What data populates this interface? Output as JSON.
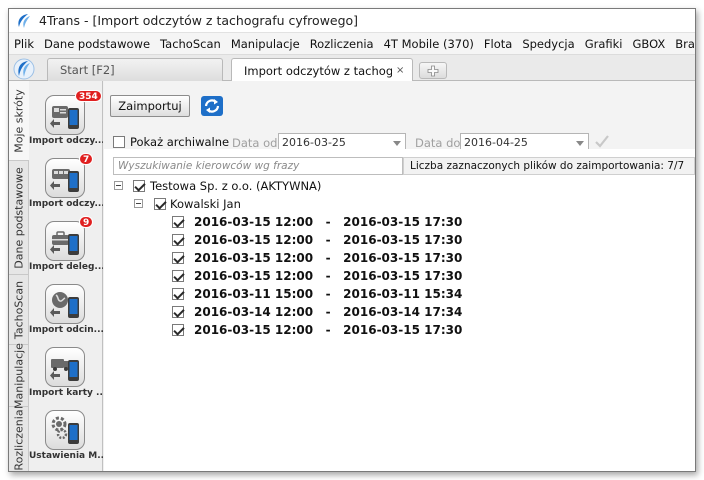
{
  "window": {
    "title": "4Trans - [Import odczytów z tachografu cyfrowego]"
  },
  "menu": {
    "items": [
      "Plik",
      "Dane podstawowe",
      "TachoScan",
      "Manipulacje",
      "Rozliczenia",
      "4T Mobile (370)",
      "Flota",
      "Spedycja",
      "Grafiki",
      "GBOX",
      "Bramka SMS"
    ]
  },
  "tabs": {
    "start_label": "Start [F2]",
    "import_label": "Import odczytów z tachografu cyfrowego",
    "close_symbol": "×"
  },
  "sidebar": {
    "vertical_tabs": [
      "Moje skróty",
      "Dane podstawowe",
      "TachoScan",
      "Manipulacje",
      "Rozliczenia"
    ],
    "items": [
      {
        "label": "Import odczy...",
        "badge": "354",
        "icon": "driver-card-import-icon"
      },
      {
        "label": "Import odczy...",
        "badge": "7",
        "icon": "vehicle-import-icon"
      },
      {
        "label": "Import deleg...",
        "badge": "9",
        "icon": "delegation-import-icon"
      },
      {
        "label": "Import odcin...",
        "badge": "",
        "icon": "segment-import-icon"
      },
      {
        "label": "Import karty ...",
        "badge": "",
        "icon": "card-import-icon"
      },
      {
        "label": "Ustawienia M...",
        "badge": "",
        "icon": "settings-gear-icon"
      }
    ]
  },
  "toolbar": {
    "import_label": "Zaimportuj"
  },
  "filters": {
    "archive_label": "Pokaż archiwalne",
    "archive_checked": false,
    "date_from_label": "Data od",
    "date_from": "2016-03-25",
    "date_to_label": "Data do",
    "date_to": "2016-04-25"
  },
  "search": {
    "placeholder": "Wyszukiwanie kierowców wg frazy",
    "count_text": "Liczba zaznaczonych plików do zaimportowania: 7/7"
  },
  "tree": {
    "company": "Testowa Sp. z o.o. (AKTYWNA)",
    "driver": "Kowalski Jan",
    "files": [
      "2016-03-15 12:00   -   2016-03-15 17:30",
      "2016-03-15 12:00   -   2016-03-15 17:30",
      "2016-03-15 12:00   -   2016-03-15 17:30",
      "2016-03-15 12:00   -   2016-03-15 17:30",
      "2016-03-11 15:00   -   2016-03-11 15:34",
      "2016-03-14 12:00   -   2016-03-14 17:34",
      "2016-03-15 12:00   -   2016-03-15 17:30"
    ]
  },
  "colors": {
    "accent_blue": "#1e6fc8",
    "badge_red": "#e02020"
  }
}
